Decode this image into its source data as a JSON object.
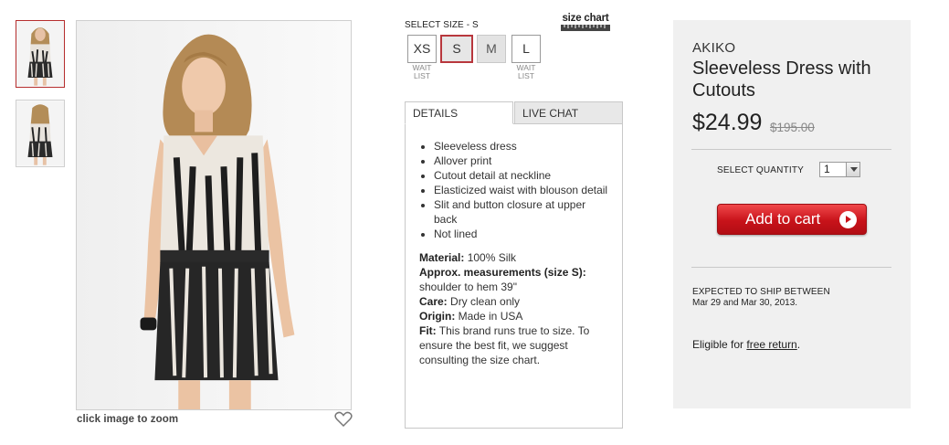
{
  "gallery": {
    "thumbnails": [
      {
        "view": "front",
        "selected": true
      },
      {
        "view": "back",
        "selected": false
      }
    ],
    "zoom_hint": "click image to zoom",
    "favorite_icon": "heart-icon"
  },
  "sizes": {
    "label": "SELECT SIZE - S",
    "size_chart_label": "size chart",
    "options": [
      {
        "label": "XS",
        "state": "available",
        "note": "WAIT LIST"
      },
      {
        "label": "S",
        "state": "selected",
        "note": ""
      },
      {
        "label": "M",
        "state": "disabled",
        "note": ""
      },
      {
        "label": "L",
        "state": "available",
        "note": "WAIT LIST"
      }
    ],
    "wait_line1": "WAIT",
    "wait_line2": "LIST"
  },
  "tabs": [
    {
      "label": "DETAILS",
      "active": true
    },
    {
      "label": "LIVE CHAT",
      "active": false
    }
  ],
  "details": {
    "bullets": [
      "Sleeveless dress",
      "Allover print",
      "Cutout detail at neckline",
      "Elasticized waist with blouson detail",
      "Slit and button closure at upper back",
      "Not lined"
    ],
    "specs": [
      {
        "label": "Material:",
        "value": " 100% Silk"
      },
      {
        "label": "Approx. measurements (size S):",
        "value": " shoulder to hem 39\""
      },
      {
        "label": "Care:",
        "value": " Dry clean only"
      },
      {
        "label": "Origin:",
        "value": " Made in USA"
      },
      {
        "label": "Fit:",
        "value": " This brand runs true to size. To ensure the best fit, we suggest consulting the size chart."
      }
    ]
  },
  "product": {
    "brand": "AKIKO",
    "title": "Sleeveless Dress with Cutouts",
    "price": "$24.99",
    "original_price": "$195.00",
    "quantity_label": "SELECT QUANTITY",
    "quantity_value": "1",
    "add_to_cart_label": "Add to cart",
    "ship_label": "EXPECTED TO SHIP BETWEEN",
    "ship_dates": "Mar 29 and Mar 30, 2013.",
    "eligible_prefix": "Eligible for ",
    "eligible_link": "free return",
    "eligible_suffix": "."
  },
  "colors": {
    "accent_red": "#c8131a",
    "selected_border": "#b8373d",
    "panel_bg": "#f0f0f0"
  }
}
